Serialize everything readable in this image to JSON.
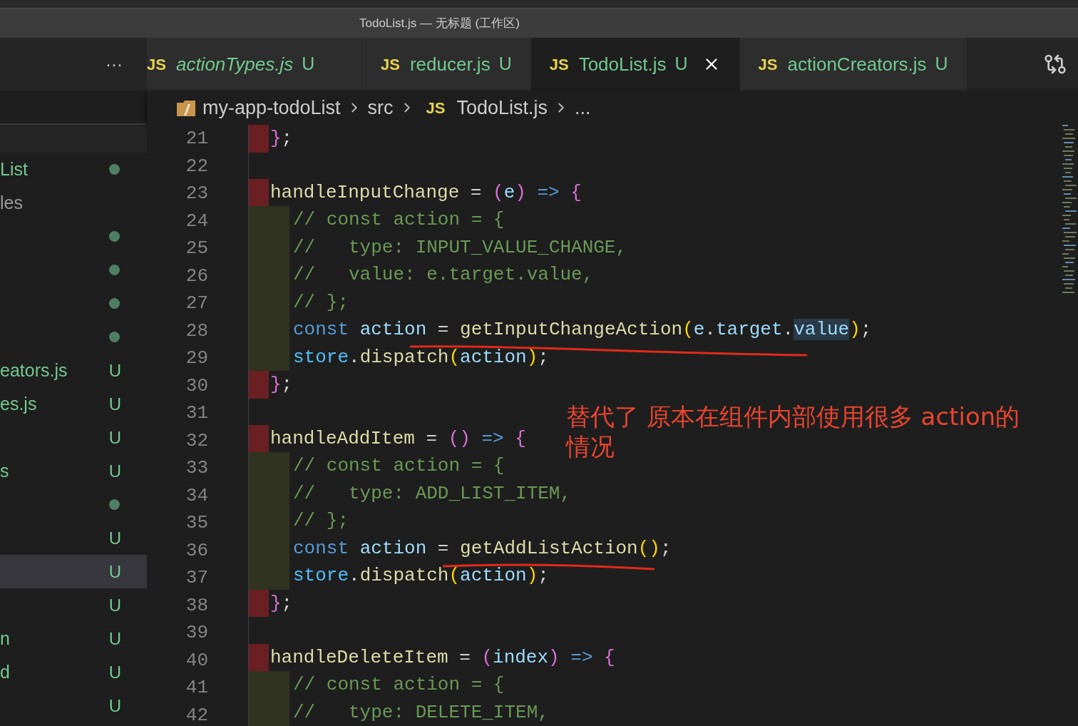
{
  "window": {
    "title": "TodoList.js — 无标题 (工作区)"
  },
  "sidebar": {
    "more": "···",
    "items": [
      {
        "label": "List",
        "kind": "dot",
        "selected": false
      },
      {
        "label": "les",
        "kind": "none",
        "selected": false
      },
      {
        "kind": "dot",
        "selected": false
      },
      {
        "kind": "dot",
        "selected": false
      },
      {
        "kind": "dot",
        "selected": false
      },
      {
        "kind": "dot",
        "selected": false
      },
      {
        "label": "eators.js",
        "kind": "untracked",
        "badge": "U",
        "selected": false
      },
      {
        "label": "es.js",
        "kind": "untracked",
        "badge": "U",
        "selected": false
      },
      {
        "kind": "untracked",
        "badge": "U",
        "selected": false
      },
      {
        "label": "s",
        "kind": "untracked",
        "badge": "U",
        "selected": false
      },
      {
        "kind": "dot",
        "selected": false
      },
      {
        "kind": "untracked",
        "badge": "U",
        "selected": false
      },
      {
        "kind": "untracked",
        "badge": "U",
        "selected": true
      },
      {
        "kind": "untracked",
        "badge": "U",
        "selected": false
      },
      {
        "label": "n",
        "kind": "untracked",
        "badge": "U",
        "selected": false
      },
      {
        "label": "d",
        "kind": "untracked",
        "badge": "U",
        "selected": false
      },
      {
        "kind": "untracked",
        "badge": "U",
        "selected": false
      }
    ]
  },
  "tabs": [
    {
      "icon": "JS",
      "label": "actionTypes.js",
      "status": "U",
      "italic": true,
      "selected": false
    },
    {
      "icon": "JS",
      "label": "reducer.js",
      "status": "U",
      "italic": false,
      "selected": false
    },
    {
      "icon": "JS",
      "label": "TodoList.js",
      "status": "U",
      "italic": false,
      "selected": true
    },
    {
      "icon": "JS",
      "label": "actionCreators.js",
      "status": "U",
      "italic": false,
      "selected": false
    }
  ],
  "breadcrumb": [
    {
      "kind": "folder",
      "text": "my-app-todoList"
    },
    {
      "kind": "plain",
      "text": "src"
    },
    {
      "kind": "js",
      "icon": "JS",
      "text": "TodoList.js"
    },
    {
      "kind": "plain",
      "text": "..."
    }
  ],
  "editor": {
    "lines": [
      {
        "num": "21",
        "kind": "deleted",
        "tokens": [
          {
            "kind": "brace",
            "text": "}"
          },
          {
            "kind": "op",
            "text": ";"
          }
        ]
      },
      {
        "num": "22",
        "kind": "plain"
      },
      {
        "num": "23",
        "kind": "deleted",
        "tokens": [
          {
            "kind": "fn",
            "text": "handleInputChange"
          },
          {
            "kind": "op",
            "text": " = "
          },
          {
            "kind": "brace",
            "text": "("
          },
          {
            "kind": "var",
            "text": "e"
          },
          {
            "kind": "brace",
            "text": ")"
          },
          {
            "kind": "kw",
            "text": " => "
          },
          {
            "kind": "brace",
            "text": "{"
          }
        ]
      },
      {
        "num": "24",
        "kind": "modified",
        "tokens": [
          {
            "kind": "cm",
            "text": "// const action = {"
          }
        ]
      },
      {
        "num": "25",
        "kind": "modified",
        "tokens": [
          {
            "kind": "cm",
            "text": "//   type: INPUT_VALUE_CHANGE,"
          }
        ]
      },
      {
        "num": "26",
        "kind": "modified",
        "tokens": [
          {
            "kind": "cm",
            "text": "//   value: e.target.value,"
          }
        ]
      },
      {
        "num": "27",
        "kind": "modified",
        "tokens": [
          {
            "kind": "cm",
            "text": "// };"
          }
        ]
      },
      {
        "num": "28",
        "kind": "modified",
        "tokens": [
          {
            "kind": "kw",
            "text": "const "
          },
          {
            "kind": "var",
            "text": "action"
          },
          {
            "kind": "op",
            "text": " = "
          },
          {
            "kind": "fn",
            "text": "getInputChangeAction"
          },
          {
            "kind": "paren",
            "text": "("
          },
          {
            "kind": "var",
            "text": "e"
          },
          {
            "kind": "op",
            "text": "."
          },
          {
            "kind": "var",
            "text": "target"
          },
          {
            "kind": "op",
            "text": "."
          },
          {
            "kind": "var",
            "text": "value",
            "highlight": true
          },
          {
            "kind": "paren",
            "text": ")"
          },
          {
            "kind": "op",
            "text": ";"
          }
        ]
      },
      {
        "num": "29",
        "kind": "modified",
        "tokens": [
          {
            "kind": "obj",
            "text": "store"
          },
          {
            "kind": "op",
            "text": "."
          },
          {
            "kind": "fn",
            "text": "dispatch"
          },
          {
            "kind": "paren",
            "text": "("
          },
          {
            "kind": "var",
            "text": "action"
          },
          {
            "kind": "paren",
            "text": ")"
          },
          {
            "kind": "op",
            "text": ";"
          }
        ]
      },
      {
        "num": "30",
        "kind": "deleted",
        "tokens": [
          {
            "kind": "brace",
            "text": "}"
          },
          {
            "kind": "op",
            "text": ";"
          }
        ]
      },
      {
        "num": "31",
        "kind": "plain"
      },
      {
        "num": "32",
        "kind": "deleted",
        "tokens": [
          {
            "kind": "fn",
            "text": "handleAddItem"
          },
          {
            "kind": "op",
            "text": " = "
          },
          {
            "kind": "brace",
            "text": "()"
          },
          {
            "kind": "kw",
            "text": " => "
          },
          {
            "kind": "brace",
            "text": "{"
          }
        ]
      },
      {
        "num": "33",
        "kind": "modified",
        "tokens": [
          {
            "kind": "cm",
            "text": "// const action = {"
          }
        ]
      },
      {
        "num": "34",
        "kind": "modified",
        "tokens": [
          {
            "kind": "cm",
            "text": "//   type: ADD_LIST_ITEM,"
          }
        ]
      },
      {
        "num": "35",
        "kind": "modified",
        "tokens": [
          {
            "kind": "cm",
            "text": "// };"
          }
        ]
      },
      {
        "num": "36",
        "kind": "modified",
        "tokens": [
          {
            "kind": "kw",
            "text": "const "
          },
          {
            "kind": "var",
            "text": "action"
          },
          {
            "kind": "op",
            "text": " = "
          },
          {
            "kind": "fn",
            "text": "getAddListAction"
          },
          {
            "kind": "paren",
            "text": "()"
          },
          {
            "kind": "op",
            "text": ";"
          }
        ]
      },
      {
        "num": "37",
        "kind": "modified",
        "tokens": [
          {
            "kind": "obj",
            "text": "store"
          },
          {
            "kind": "op",
            "text": "."
          },
          {
            "kind": "fn",
            "text": "dispatch"
          },
          {
            "kind": "paren",
            "text": "("
          },
          {
            "kind": "var",
            "text": "action"
          },
          {
            "kind": "paren",
            "text": ")"
          },
          {
            "kind": "op",
            "text": ";"
          }
        ]
      },
      {
        "num": "38",
        "kind": "deleted",
        "tokens": [
          {
            "kind": "brace",
            "text": "}"
          },
          {
            "kind": "op",
            "text": ";"
          }
        ]
      },
      {
        "num": "39",
        "kind": "plain"
      },
      {
        "num": "40",
        "kind": "deleted",
        "tokens": [
          {
            "kind": "fn",
            "text": "handleDeleteItem"
          },
          {
            "kind": "op",
            "text": " = "
          },
          {
            "kind": "brace",
            "text": "("
          },
          {
            "kind": "var",
            "text": "index"
          },
          {
            "kind": "brace",
            "text": ")"
          },
          {
            "kind": "kw",
            "text": " => "
          },
          {
            "kind": "brace",
            "text": "{"
          }
        ]
      },
      {
        "num": "41",
        "kind": "modified",
        "tokens": [
          {
            "kind": "cm",
            "text": "// const action = {"
          }
        ]
      },
      {
        "num": "42",
        "kind": "modified",
        "tokens": [
          {
            "kind": "cm",
            "text": "//   type: DELETE_ITEM,"
          }
        ]
      }
    ]
  },
  "annotation": {
    "lines": [
      "替代了 原本在组件内部使用很多 action的",
      "情况"
    ]
  }
}
